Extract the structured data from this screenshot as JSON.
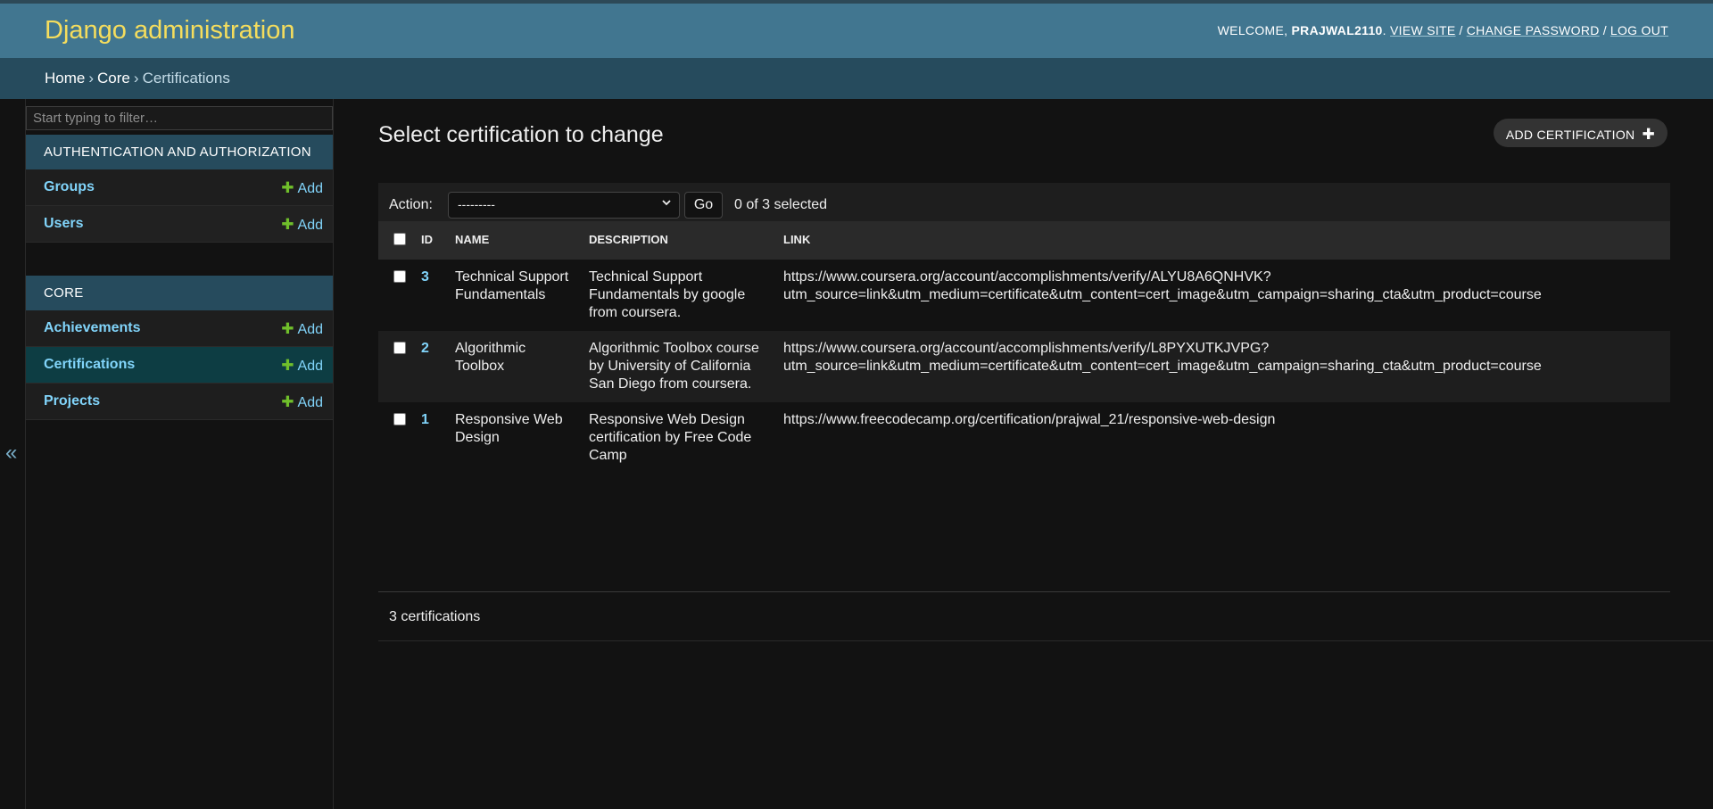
{
  "header": {
    "branding": "Django administration",
    "welcome": "Welcome,",
    "username": "prajwal2110",
    "view_site": "View site",
    "change_password": "Change password",
    "log_out": "Log out"
  },
  "breadcrumbs": {
    "home": "Home",
    "app": "Core",
    "current": "Certifications",
    "separator": "›"
  },
  "sidebar": {
    "filter_placeholder": "Start typing to filter…",
    "toggle_glyph": "«",
    "add_label": "Add",
    "apps": [
      {
        "caption": "Authentication and Authorization",
        "models": [
          {
            "name": "Groups"
          },
          {
            "name": "Users"
          }
        ]
      },
      {
        "caption": "Core",
        "models": [
          {
            "name": "Achievements"
          },
          {
            "name": "Certifications",
            "current": true
          },
          {
            "name": "Projects"
          }
        ]
      }
    ]
  },
  "main": {
    "title": "Select certification to change",
    "add_button": "Add certification",
    "actions": {
      "label": "Action:",
      "selected_option": "---------",
      "go": "Go",
      "selection_count": "0 of 3 selected"
    },
    "table": {
      "columns": [
        "ID",
        "Name",
        "Description",
        "Link"
      ],
      "rows": [
        {
          "id": "3",
          "name": "Technical Support Fundamentals",
          "description": "Technical Support Fundamentals by google from coursera.",
          "link_line1": "https://www.coursera.org/account/accomplishments/verify/ALYU8A6QNHVK?",
          "link_line2": "utm_source=link&utm_medium=certificate&utm_content=cert_image&utm_campaign=sharing_cta&utm_product=course"
        },
        {
          "id": "2",
          "name": "Algorithmic Toolbox",
          "description": "Algorithmic Toolbox course by University of California San Diego from coursera.",
          "link_line1": "https://www.coursera.org/account/accomplishments/verify/L8PYXUTKJVPG?",
          "link_line2": "utm_source=link&utm_medium=certificate&utm_content=cert_image&utm_campaign=sharing_cta&utm_product=course"
        },
        {
          "id": "1",
          "name": "Responsive Web Design",
          "description": "Responsive Web Design certification by Free Code Camp",
          "link_line1": "https://www.freecodecamp.org/certification/prajwal_21/responsive-web-design",
          "link_line2": ""
        }
      ]
    },
    "paginator": "3 certifications"
  },
  "colors": {
    "header_bg": "#417690",
    "branding": "#f5dd5d",
    "breadcrumb_bg": "#264b5d",
    "link": "#81d4fa",
    "add_plus": "#70bf2b",
    "current_row": "#0d3d43"
  }
}
